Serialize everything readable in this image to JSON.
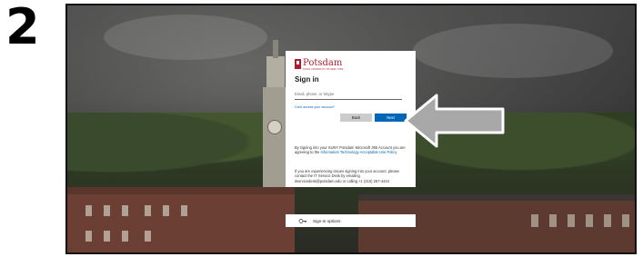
{
  "step": {
    "number": "2"
  },
  "signin": {
    "logo_name": "Potsdam",
    "logo_tagline": "State University of New York",
    "title": "Sign in",
    "input_placeholder": "Email, phone, or Skype",
    "cant_access": "Can't access your account?",
    "back_label": "Back",
    "next_label": "Next",
    "terms_prefix": "By signing into your SUNY Potsdam Microsoft 365 Account you are agreeing to the ",
    "terms_link": "Information Technology Acceptable Use Policy",
    "support_text": "If you are experiencing issues signing into your account, please contact the IT Service Desk by emailing itservicedesk@potsdam.edu or calling +1 (315) 267-4444"
  },
  "signin_options": {
    "label": "Sign-in options",
    "icon": "key-icon"
  },
  "colors": {
    "brand_red": "#b01c2e",
    "ms_blue": "#0067b8",
    "arrow_fill": "#a8a8a8",
    "arrow_stroke": "#ffffff"
  },
  "annotation": {
    "arrow": "left-arrow pointing at Next button"
  }
}
